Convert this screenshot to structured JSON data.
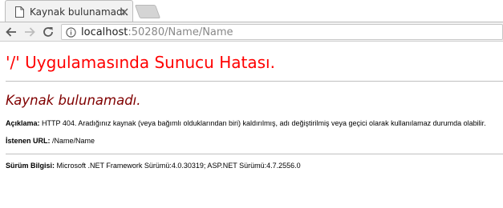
{
  "browser": {
    "tab_title": "Kaynak bulunamadı.",
    "url_host": "localhost",
    "url_path": ":50280/Name/Name"
  },
  "page": {
    "heading": "'/' Uygulamasında Sunucu Hatası.",
    "subheading": "Kaynak bulunamadı.",
    "description_label": "Açıklama:",
    "description_text": "HTTP 404. Aradığınız kaynak (veya bağımlı olduklarından biri) kaldırılmış, adı değiştirilmiş veya geçici olarak kullanılamaz durumda olabilir.",
    "requested_url_label": "İstenen URL:",
    "requested_url_value": "/Name/Name",
    "version_label": "Sürüm Bilgisi:",
    "version_text": "Microsoft .NET Framework Sürümü:4.0.30319; ASP.NET Sürümü:4.7.2556.0"
  },
  "icons": {
    "tab": "page-icon",
    "close": "close-icon",
    "back": "back-arrow-icon",
    "forward": "forward-arrow-icon",
    "reload": "reload-icon",
    "info": "info-icon"
  },
  "colors": {
    "heading": "#ff0000",
    "subheading": "#800000"
  }
}
